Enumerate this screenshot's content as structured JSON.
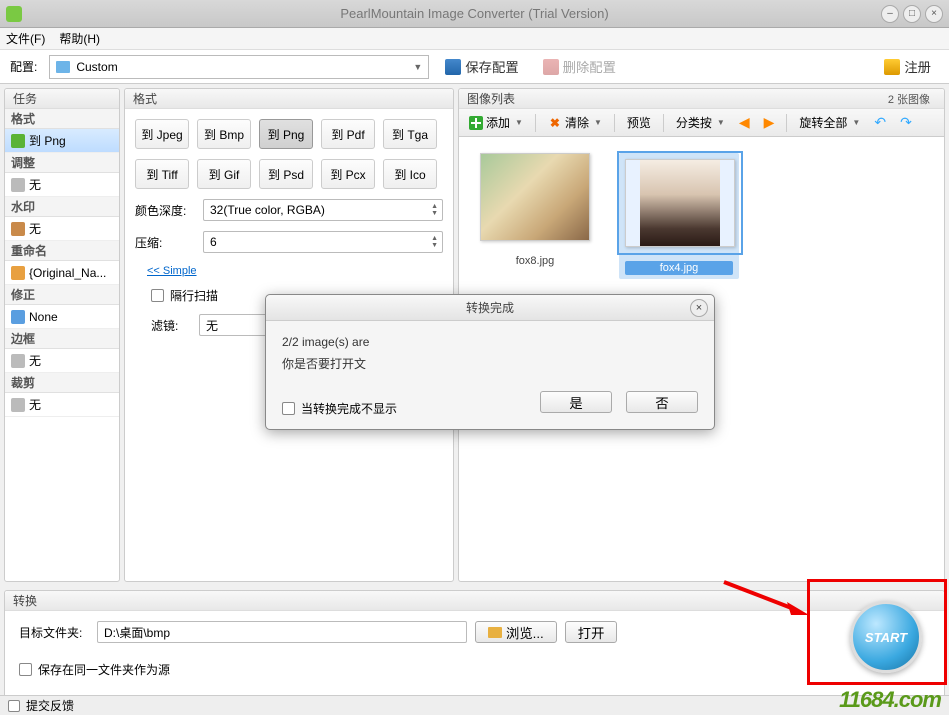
{
  "titlebar": {
    "title": "PearlMountain Image Converter (Trial Version)"
  },
  "menu": {
    "file": "文件(F)",
    "help": "帮助(H)"
  },
  "toolbar": {
    "config_label": "配置:",
    "preset": "Custom",
    "save_config": "保存配置",
    "delete_config": "删除配置",
    "register": "注册"
  },
  "sidebar": {
    "header": "任务",
    "groups": [
      {
        "label": "格式",
        "item": "到 Png",
        "selected": true,
        "icon": "mi-green"
      },
      {
        "label": "调整",
        "item": "无",
        "icon": "mi-gray"
      },
      {
        "label": "水印",
        "item": "无",
        "icon": "mi-brown"
      },
      {
        "label": "重命名",
        "item": "{Original_Na...",
        "icon": "mi-orange"
      },
      {
        "label": "修正",
        "item": "None",
        "icon": "mi-blue"
      },
      {
        "label": "边框",
        "item": "无",
        "icon": "mi-gray"
      },
      {
        "label": "裁剪",
        "item": "无",
        "icon": "mi-gray"
      }
    ]
  },
  "format": {
    "header": "格式",
    "buttons": [
      "到 Jpeg",
      "到 Bmp",
      "到 Png",
      "到 Pdf",
      "到 Tga",
      "到 Tiff",
      "到 Gif",
      "到 Psd",
      "到 Pcx",
      "到 Ico"
    ],
    "active": "到 Png",
    "color_depth_label": "颜色深度:",
    "color_depth": "32(True color, RGBA)",
    "compression_label": "压缩:",
    "compression": "6",
    "simple_link": "<< Simple",
    "interlace": "隔行扫描",
    "filter_label": "滤镜:",
    "filter": "无"
  },
  "images": {
    "header": "图像列表",
    "count": "2 张图像",
    "toolbar": {
      "add": "添加",
      "clear": "清除",
      "preview": "预览",
      "sort": "分类按",
      "rotate": "旋转全部"
    },
    "thumbs": [
      {
        "name": "fox8.jpg",
        "selected": false,
        "kind": "photo"
      },
      {
        "name": "fox4.jpg",
        "selected": true,
        "kind": "portrait"
      }
    ]
  },
  "convert": {
    "header": "转换",
    "dest_label": "目标文件夹:",
    "dest_path": "D:\\桌面\\bmp",
    "browse": "浏览...",
    "open": "打开",
    "save_same": "保存在同一文件夹作为源",
    "start": "START"
  },
  "dialog": {
    "title": "转换完成",
    "line1": "2/2 image(s) are",
    "line2": "你是否要打开文",
    "checkbox": "当转换完成不显示",
    "yes": "是",
    "no": "否"
  },
  "status": {
    "feedback": "提交反馈"
  },
  "watermark": "11684.com"
}
